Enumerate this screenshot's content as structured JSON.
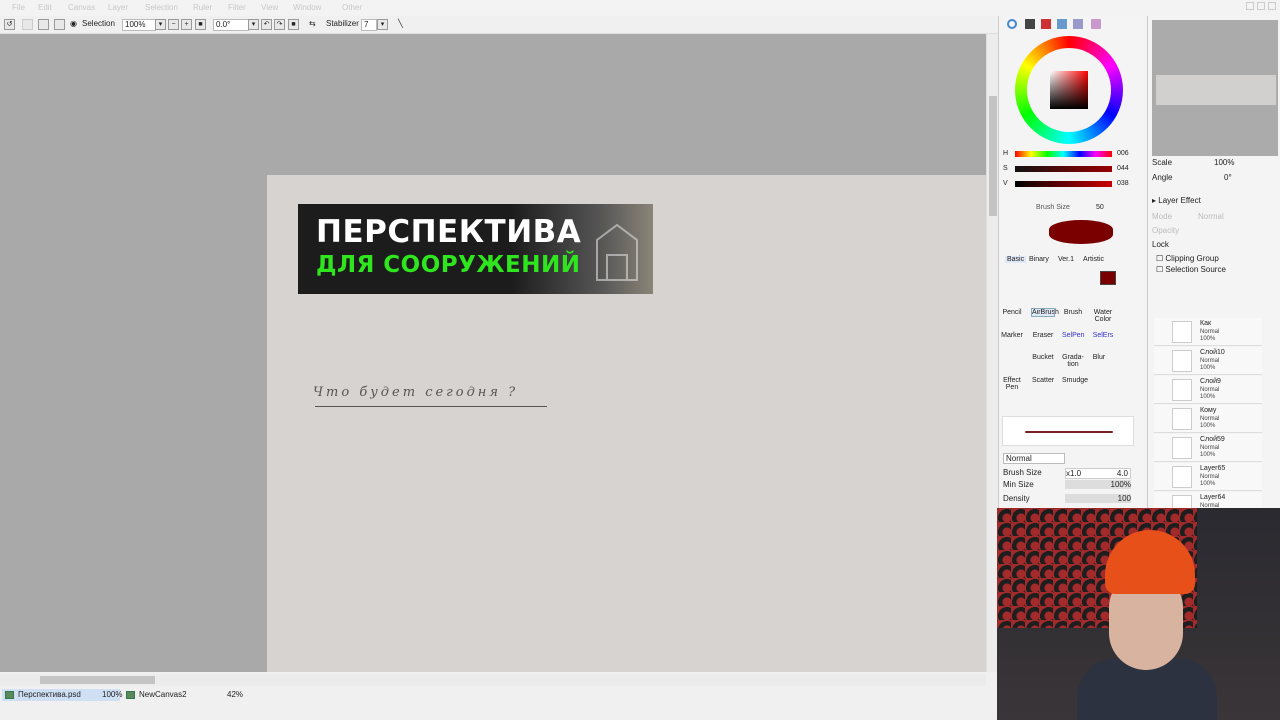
{
  "menubar": {
    "items": [
      "File",
      "Edit",
      "Canvas",
      "Layer",
      "Selection",
      "Ruler",
      "Filter",
      "View",
      "Window",
      "Other"
    ]
  },
  "toolbar": {
    "selection_label": "Selection",
    "zoom": "100%",
    "angle": "0.0°",
    "stabilizer_label": "Stabilizer",
    "stabilizer_value": "7"
  },
  "canvas": {
    "banner_line1": "ПЕРСПЕКТИВА",
    "banner_line2": "ДЛЯ СООРУЖЕНИЙ",
    "handwritten": "Что будет сегодня ?"
  },
  "tabs": [
    {
      "label": "Перспектива.psd",
      "zoom": "100%"
    },
    {
      "label": "NewCanvas2",
      "zoom": "42%"
    }
  ],
  "color": {
    "h": "006",
    "s": "044",
    "v": "038",
    "accent": "#7a0000"
  },
  "brush": {
    "size_label": "Brush Size",
    "size_value": "50",
    "tool_tabs": [
      "Basic",
      "Binary",
      "Ver.1",
      "Artistic"
    ],
    "tools": [
      "Pencil",
      "AirBrush",
      "Brush",
      "Water Color",
      "Marker",
      "Eraser",
      "SelPen",
      "SelErs",
      "Bucket",
      "Grada-tion",
      "Blur",
      "Effect Pen",
      "Scatter",
      "Smudge"
    ],
    "blend_mode": "Normal",
    "brush_size_label": "Brush Size",
    "brush_size_mult": "x1.0",
    "brush_size_value": "4.0",
    "min_size_label": "Min Size",
    "min_size_value": "100%",
    "density_label": "Density",
    "density_value": "100"
  },
  "navigator": {
    "scale_label": "Scale",
    "scale_value": "100%",
    "angle_label": "Angle",
    "angle_value": "0°"
  },
  "layer_panel": {
    "layer_effect": "Layer Effect",
    "mode_label": "Mode",
    "mode_value": "Normal",
    "opacity_label": "Opacity",
    "lock_label": "Lock",
    "clipping": "Clipping Group",
    "selection_source": "Selection Source",
    "layers": [
      {
        "name": "Как",
        "mode": "Normal",
        "opacity": "100%"
      },
      {
        "name": "Слой10",
        "mode": "Normal",
        "opacity": "100%"
      },
      {
        "name": "Слой9",
        "mode": "Normal",
        "opacity": "100%"
      },
      {
        "name": "Кому",
        "mode": "Normal",
        "opacity": "100%"
      },
      {
        "name": "Слой59",
        "mode": "Normal",
        "opacity": "100%"
      },
      {
        "name": "Layer65",
        "mode": "Normal",
        "opacity": "100%"
      },
      {
        "name": "Layer64",
        "mode": "Normal",
        "opacity": ""
      }
    ]
  }
}
